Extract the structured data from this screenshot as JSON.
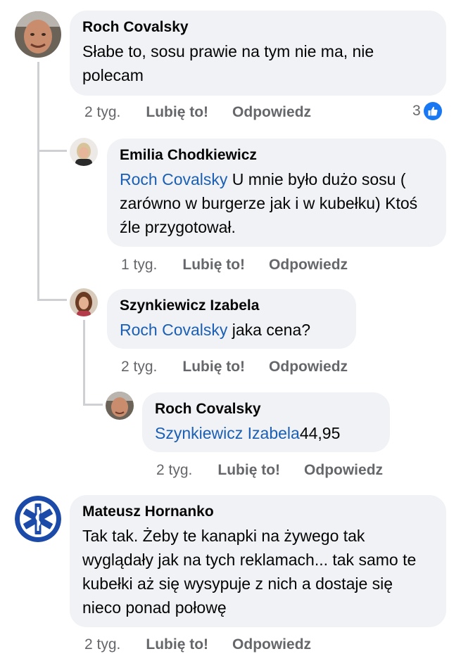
{
  "comments": [
    {
      "author": "Roch Covalsky",
      "text": "Słabe to, sosu prawie na tym nie ma, nie polecam",
      "time": "2 tyg.",
      "like": "Lubię to!",
      "reply": "Odpowiedz",
      "reactions": "3",
      "replies": [
        {
          "author": "Emilia Chodkiewicz",
          "mention": "Roch Covalsky",
          "text": " U mnie było dużo sosu ( zarówno w burgerze jak i w kubełku) Ktoś źle przygotował.",
          "time": "1 tyg.",
          "like": "Lubię to!",
          "reply": "Odpowiedz"
        },
        {
          "author": "Szynkiewicz Izabela",
          "mention": "Roch Covalsky",
          "text": " jaka cena?",
          "time": "2 tyg.",
          "like": "Lubię to!",
          "reply": "Odpowiedz",
          "replies": [
            {
              "author": "Roch Covalsky",
              "mention": "Szynkiewicz Izabela",
              "text": "44,95",
              "time": "2 tyg.",
              "like": "Lubię to!",
              "reply": "Odpowiedz"
            }
          ]
        }
      ]
    },
    {
      "author": "Mateusz Hornanko",
      "text": "Tak tak. Żeby te kanapki na żywego tak wyglądały jak na tych reklamach... tak samo te kubełki aż się wysypuje z nich a dostaje się nieco ponad  połowę",
      "time": "2 tyg.",
      "like": "Lubię to!",
      "reply": "Odpowiedz"
    }
  ],
  "colors": {
    "bubble": "#f0f2f5",
    "mention": "#1a5fb4",
    "meta": "#65676b",
    "like_badge": "#1877f2"
  }
}
